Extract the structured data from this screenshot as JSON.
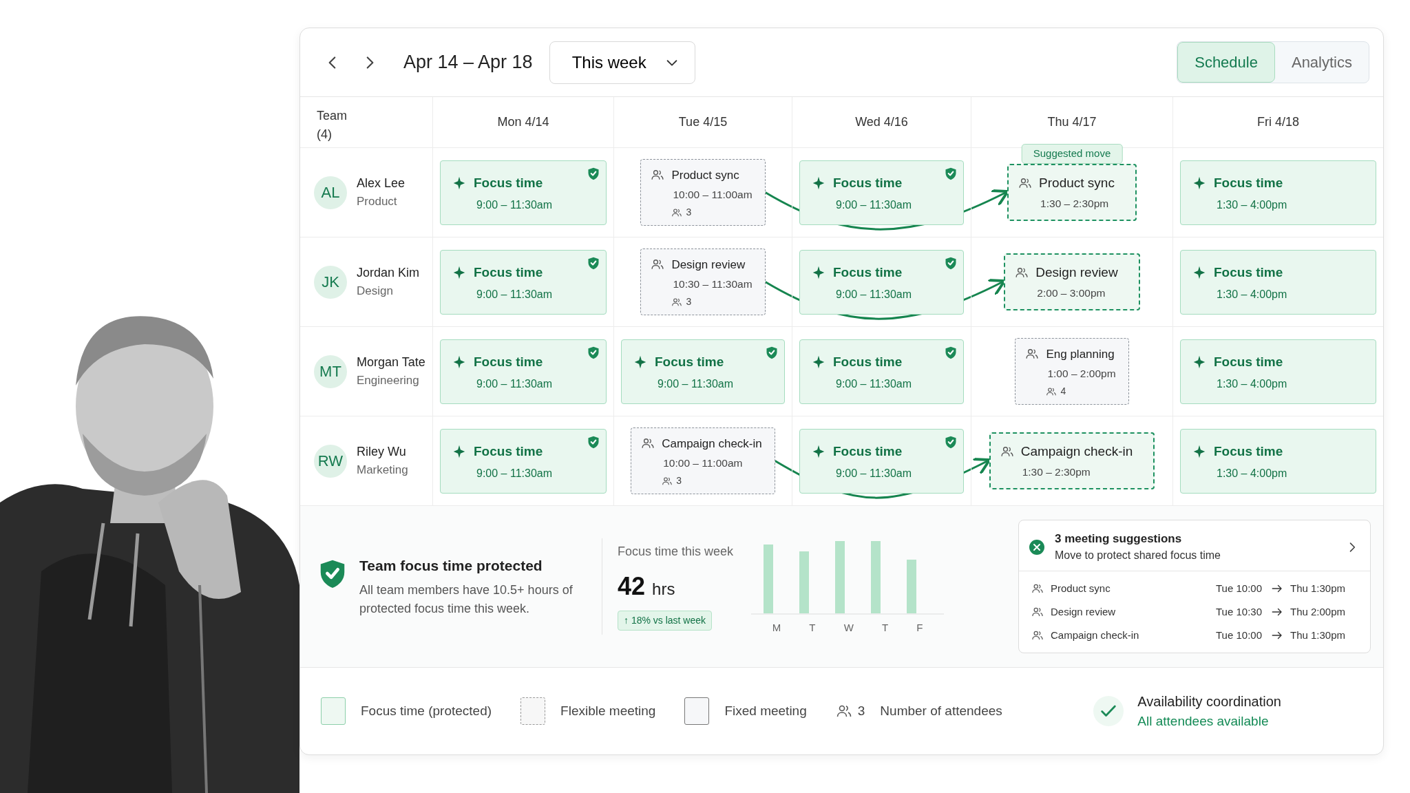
{
  "toolbar": {
    "date_range": "Apr 14 – Apr 18",
    "range_select": "This week",
    "view_tabs": [
      {
        "label": "Schedule",
        "selected": true
      },
      {
        "label": "Analytics",
        "selected": false
      }
    ]
  },
  "grid": {
    "team_label": "Team",
    "team_count": "(4)",
    "days": [
      "Mon 4/14",
      "Tue 4/15",
      "Wed 4/16",
      "Thu 4/17",
      "Fri 4/18"
    ],
    "rows": [
      {
        "initials": "AL",
        "name": "Alex Lee",
        "role": "Product",
        "events": [
          {
            "kind": "focus",
            "title": "Focus time",
            "time": "9:00 – 11:30am",
            "protected": true
          },
          {
            "kind": "flexible",
            "title": "Product sync",
            "time": "10:00 – 11:00am",
            "attendees": "3"
          },
          {
            "kind": "focus",
            "title": "Focus time",
            "time": "9:00 – 11:30am",
            "protected": true
          },
          {
            "kind": "suggested",
            "title": "Product sync",
            "time": "1:30 – 2:30pm",
            "badge": "Suggested move"
          },
          {
            "kind": "focus",
            "title": "Focus time",
            "time": "1:30 – 4:00pm",
            "protected": false
          }
        ]
      },
      {
        "initials": "JK",
        "name": "Jordan Kim",
        "role": "Design",
        "events": [
          {
            "kind": "focus",
            "title": "Focus time",
            "time": "9:00 – 11:30am",
            "protected": true
          },
          {
            "kind": "flexible",
            "title": "Design review",
            "time": "10:30 – 11:30am",
            "attendees": "3"
          },
          {
            "kind": "focus",
            "title": "Focus time",
            "time": "9:00 – 11:30am",
            "protected": true
          },
          {
            "kind": "suggested",
            "title": "Design review",
            "time": "2:00 – 3:00pm"
          },
          {
            "kind": "focus",
            "title": "Focus time",
            "time": "1:30 – 4:00pm",
            "protected": false
          }
        ]
      },
      {
        "initials": "MT",
        "name": "Morgan Tate",
        "role": "Engineering",
        "events": [
          {
            "kind": "focus",
            "title": "Focus time",
            "time": "9:00 – 11:30am",
            "protected": true
          },
          {
            "kind": "focus",
            "title": "Focus time",
            "time": "9:00 – 11:30am",
            "protected": true
          },
          {
            "kind": "focus",
            "title": "Focus time",
            "time": "9:00 – 11:30am",
            "protected": true
          },
          {
            "kind": "flexible",
            "title": "Eng planning",
            "time": "1:00 – 2:00pm",
            "attendees": "4"
          },
          {
            "kind": "focus",
            "title": "Focus time",
            "time": "1:30 – 4:00pm",
            "protected": false
          }
        ]
      },
      {
        "initials": "RW",
        "name": "Riley Wu",
        "role": "Marketing",
        "events": [
          {
            "kind": "focus",
            "title": "Focus time",
            "time": "9:00 – 11:30am",
            "protected": true
          },
          {
            "kind": "flexible",
            "title": "Campaign check-in",
            "time": "10:00 – 11:00am",
            "attendees": "3"
          },
          {
            "kind": "focus",
            "title": "Focus time",
            "time": "9:00 – 11:30am",
            "protected": true
          },
          {
            "kind": "suggested",
            "title": "Campaign check-in",
            "time": "1:30 – 2:30pm"
          },
          {
            "kind": "focus",
            "title": "Focus time",
            "time": "1:30 – 4:00pm",
            "protected": false
          }
        ]
      }
    ]
  },
  "summary": {
    "title": "Team focus time protected",
    "text": "All team members have 10.5+ hours of protected focus time this week.",
    "stat_label": "Focus time this week",
    "stat_value": "42",
    "stat_unit": "hrs",
    "change": "↑ 18% vs last week",
    "chart_labels": [
      "M",
      "T",
      "W",
      "T",
      "F"
    ]
  },
  "suggestions": {
    "title": "3 meeting suggestions",
    "subtitle": "Move to protect shared focus time",
    "items": [
      {
        "name": "Product sync",
        "from": "Tue 10:00",
        "to": "Thu 1:30pm"
      },
      {
        "name": "Design review",
        "from": "Tue 10:30",
        "to": "Thu 2:00pm"
      },
      {
        "name": "Campaign check-in",
        "from": "Tue 10:00",
        "to": "Thu 1:30pm"
      }
    ]
  },
  "legend": [
    {
      "kind": "focus",
      "label": "Focus time (protected)"
    },
    {
      "kind": "flexible",
      "label": "Flexible meeting"
    },
    {
      "kind": "fixed",
      "label": "Fixed meeting"
    },
    {
      "kind": "attendees",
      "count": "3",
      "label": "Number of attendees"
    }
  ],
  "availability": {
    "title": "Availability coordination",
    "status": "All attendees available"
  }
}
